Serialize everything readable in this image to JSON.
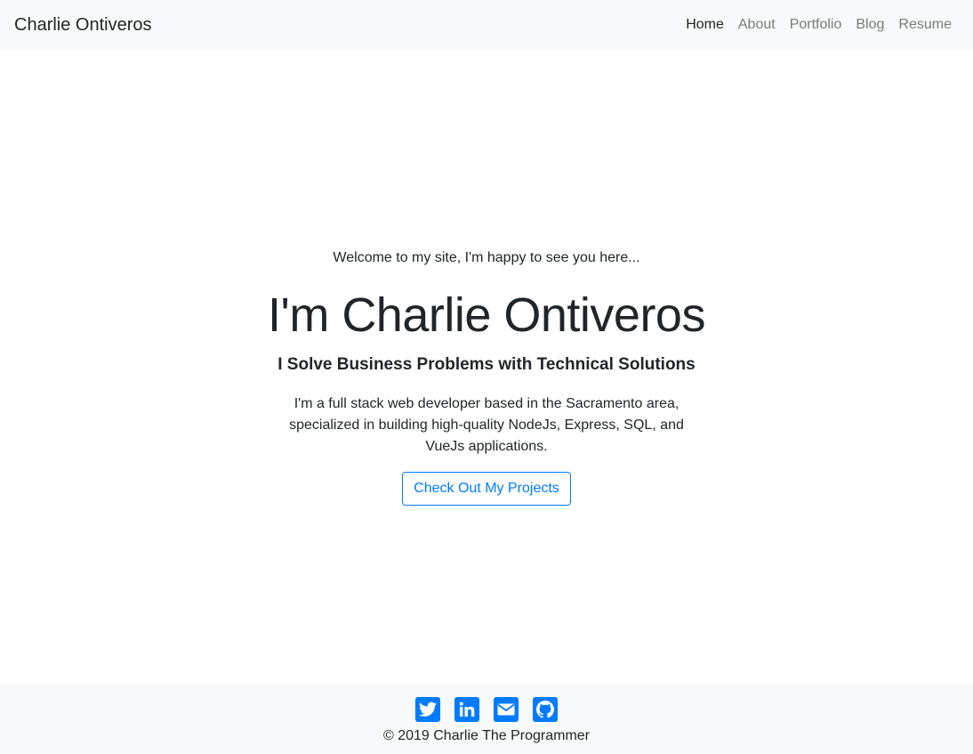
{
  "navbar": {
    "brand": "Charlie Ontiveros",
    "links": [
      "Home",
      "About",
      "Portfolio",
      "Blog",
      "Resume"
    ],
    "active": "Home"
  },
  "hero": {
    "welcome": "Welcome to my site, I'm happy to see you here...",
    "headline": "I'm Charlie Ontiveros",
    "subhead": "I Solve Business Problems with Technical Solutions",
    "bio": "I'm a full stack web developer based in the Sacramento area, specialized in building high-quality NodeJs, Express, SQL, and VueJs applications.",
    "cta_label": "Check Out My Projects"
  },
  "footer": {
    "social_icons": [
      "twitter-icon",
      "linkedin-icon",
      "email-icon",
      "github-icon"
    ],
    "copyright": "© 2019 Charlie The Programmer"
  },
  "colors": {
    "accent": "#007bff",
    "navbar_bg": "#f8f9fa",
    "text": "#212529",
    "muted": "#7a7a7a"
  }
}
